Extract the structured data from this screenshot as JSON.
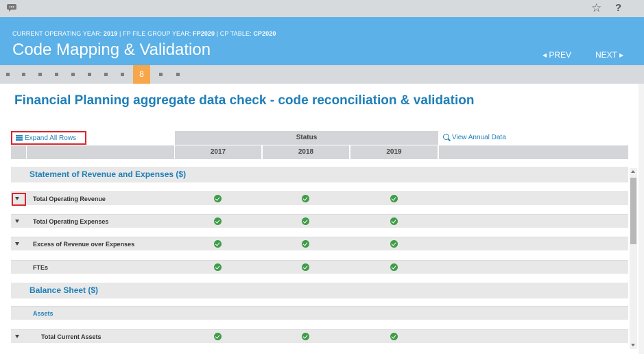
{
  "topbar": {
    "chat_icon": "chat-bubble-icon",
    "star_icon": "☆",
    "help_icon": "?"
  },
  "header": {
    "context_label_year": "CURRENT OPERATING YEAR: ",
    "context_year": "2019",
    "context_sep1": " | FP FILE GROUP YEAR: ",
    "context_fp": "FP2020",
    "context_sep2": " | CP TABLE: ",
    "context_cp": "CP2020",
    "title": "Code Mapping & Validation",
    "prev_label": "◂ PREV",
    "next_label": "NEXT ▸"
  },
  "stepper": {
    "current_step": "8",
    "total_steps": 10
  },
  "main": {
    "heading": "Financial Planning aggregate data check - code reconciliation & validation",
    "expand_all_label": "Expand All Rows",
    "status_label": "Status",
    "view_annual_label": "View Annual Data",
    "years": [
      "2017",
      "2018",
      "2019"
    ]
  },
  "groups": [
    {
      "title": "Statement of Revenue and Expenses ($)"
    },
    {
      "title": "Balance Sheet ($)"
    }
  ],
  "rows": [
    {
      "label": "Total Operating Revenue",
      "expandable": true,
      "status": [
        "ok",
        "ok",
        "ok"
      ]
    },
    {
      "label": "Total Operating Expenses",
      "expandable": true,
      "status": [
        "ok",
        "ok",
        "ok"
      ]
    },
    {
      "label": "Excess of Revenue over Expenses",
      "expandable": true,
      "status": [
        "ok",
        "ok",
        "ok"
      ]
    },
    {
      "label": "FTEs",
      "expandable": false,
      "status": [
        "ok",
        "ok",
        "ok"
      ]
    },
    {
      "label": "Assets",
      "expandable": false,
      "status": []
    },
    {
      "label": "Total Current Assets",
      "expandable": true,
      "status": [
        "ok",
        "ok",
        "ok"
      ]
    }
  ],
  "colors": {
    "header_bg": "#5bb1e8",
    "accent": "#1e7fb8",
    "step_active": "#f7a64a",
    "ok": "#3f9c47",
    "highlight": "#d9262d"
  }
}
